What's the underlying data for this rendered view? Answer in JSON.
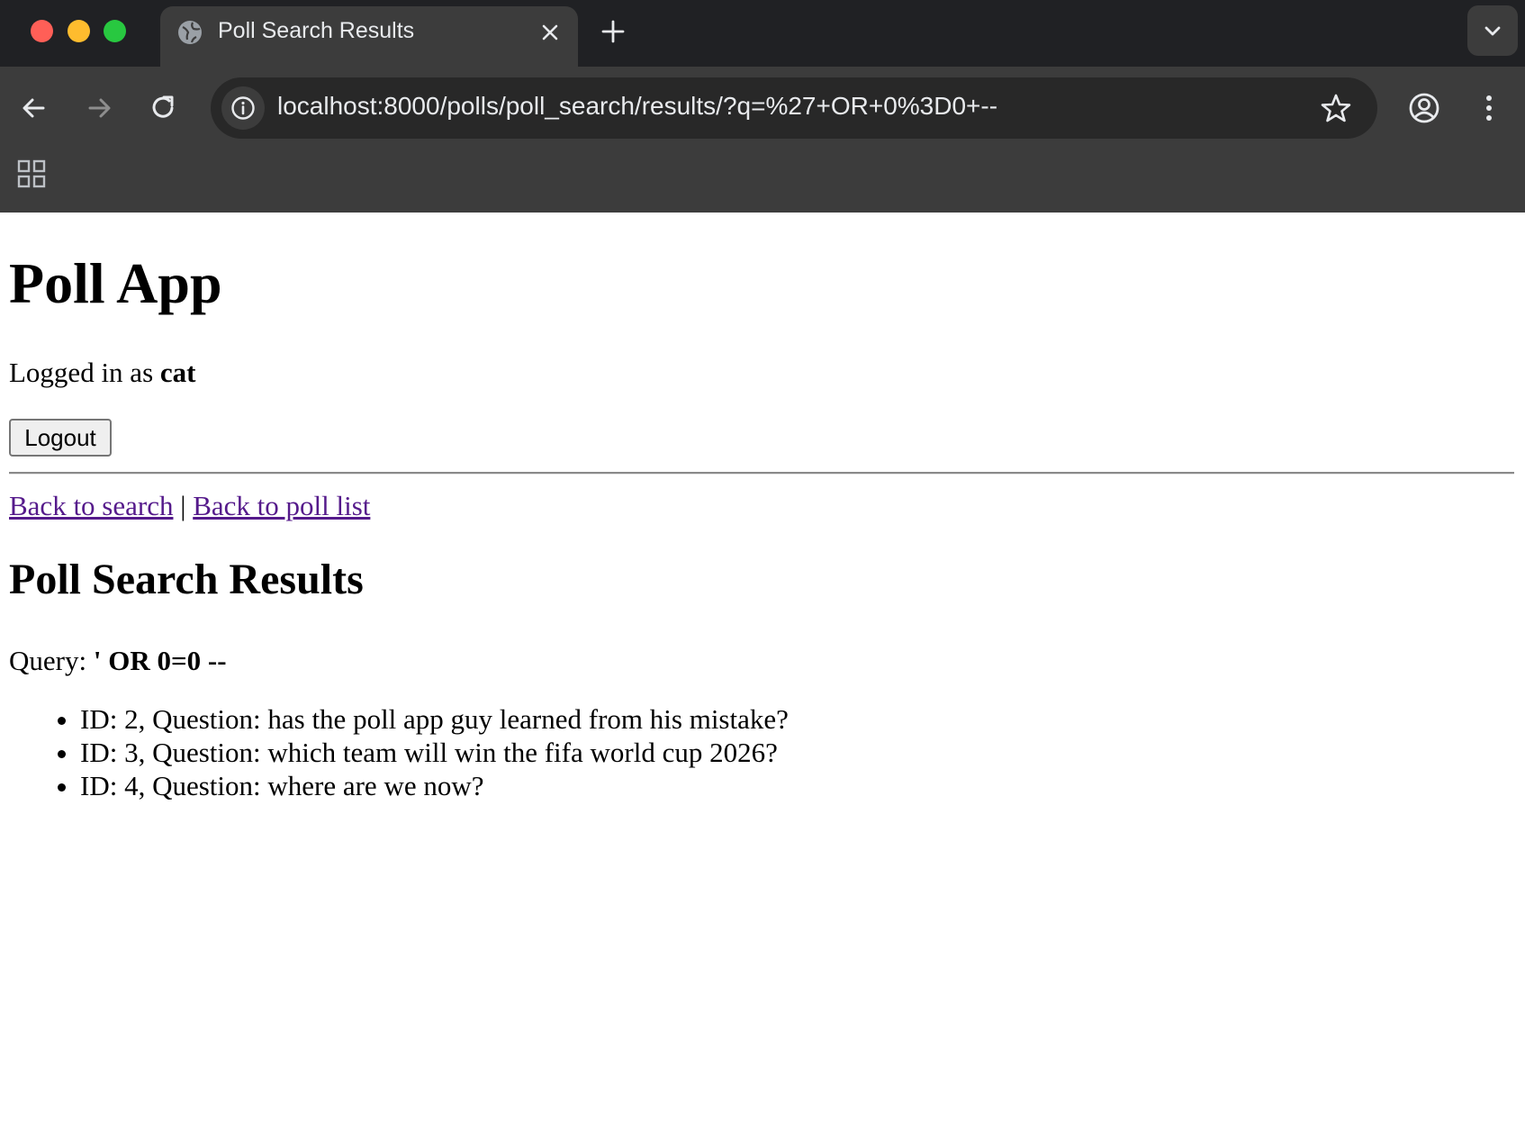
{
  "browser": {
    "tab_title": "Poll Search Results",
    "url": "localhost:8000/polls/poll_search/results/?q=%27+OR+0%3D0+--",
    "icons": [
      "globe-icon",
      "close-icon",
      "plus-icon",
      "chevron-down-icon",
      "back-arrow-icon",
      "forward-arrow-icon",
      "reload-icon",
      "info-icon",
      "star-icon",
      "profile-icon",
      "kebab-menu-icon",
      "apps-grid-icon"
    ],
    "colors": {
      "tabbar": "#202124",
      "toolbar": "#3c3c3c",
      "urlbar": "#282828"
    }
  },
  "page": {
    "app_title": "Poll App",
    "logged_in_prefix": "Logged in as ",
    "username": "cat",
    "logout_label": "Logout",
    "back_to_search": "Back to search",
    "separator": " | ",
    "back_to_poll_list": "Back to poll list",
    "results_heading": "Poll Search Results",
    "query_label": "Query: ",
    "query_value": "' OR 0=0 --",
    "results": [
      {
        "text": "ID: 2, Question: has the poll app guy learned from his mistake?"
      },
      {
        "text": "ID: 3, Question: which team will win the fifa world cup 2026?"
      },
      {
        "text": "ID: 4, Question: where are we now?"
      }
    ],
    "colors": {
      "visited_link": "#551a8b"
    }
  }
}
